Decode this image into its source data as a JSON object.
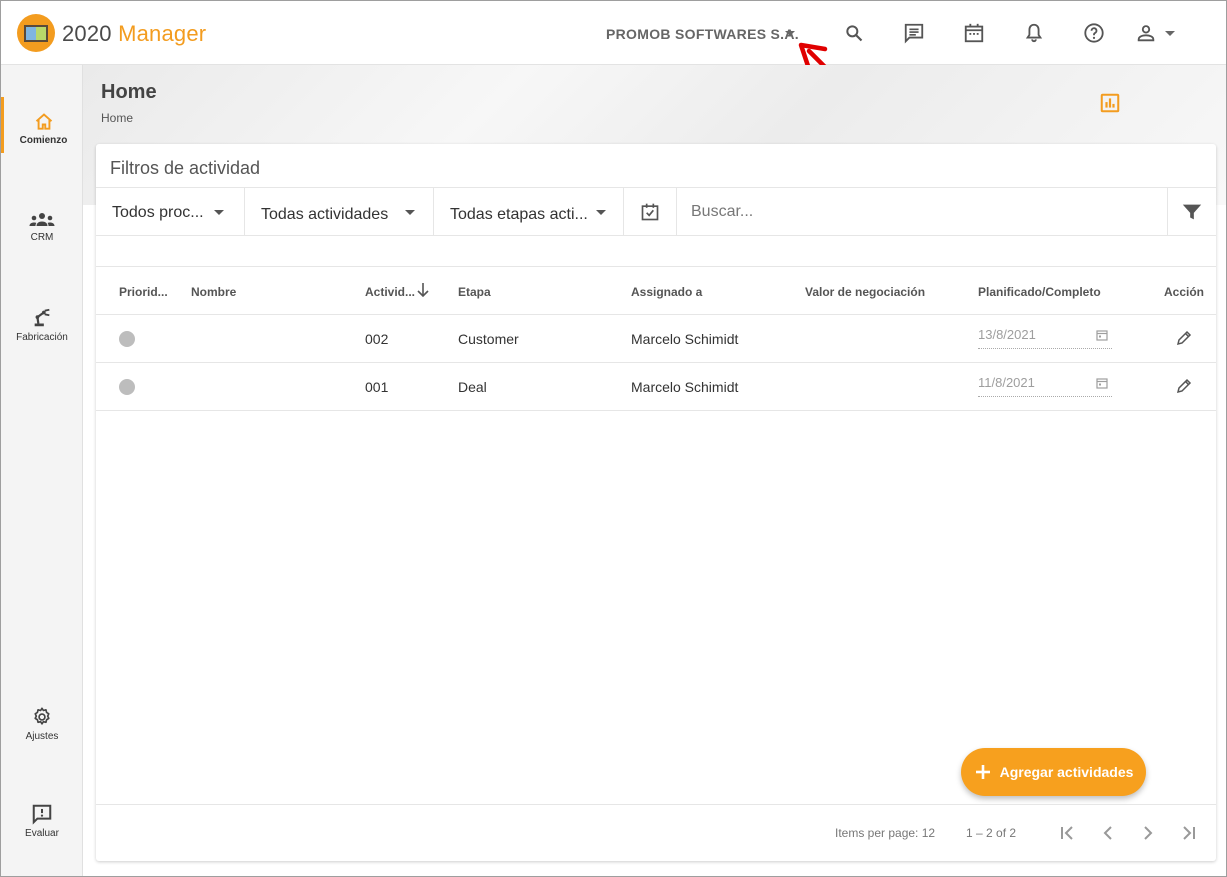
{
  "app": {
    "brand_prefix": "2020",
    "brand_suffix": "Manager",
    "company": "PROMOB SOFTWARES S.A."
  },
  "topbar": {
    "icons": [
      "search-icon",
      "chat-icon",
      "calendar-icon",
      "bell-icon",
      "help-icon",
      "user-icon"
    ]
  },
  "sidebar": {
    "items": [
      {
        "label": "Comienzo",
        "icon": "home-icon",
        "active": true
      },
      {
        "label": "CRM",
        "icon": "group-icon"
      },
      {
        "label": "Fabricación",
        "icon": "robot-arm-icon"
      },
      {
        "label": "Ajustes",
        "icon": "gear-icon"
      },
      {
        "label": "Evaluar",
        "icon": "feedback-icon"
      }
    ]
  },
  "page": {
    "title": "Home",
    "breadcrumb": "Home"
  },
  "card": {
    "title": "Filtros de actividad",
    "filters": {
      "process": "Todos proc...",
      "activities": "Todas actividades",
      "stages": "Todas etapas acti...",
      "search_placeholder": "Buscar..."
    }
  },
  "table": {
    "headers": {
      "priority": "Priorid...",
      "name": "Nombre",
      "activity": "Activid...",
      "stage": "Etapa",
      "assigned": "Assignado a",
      "value": "Valor de negociación",
      "planned": "Planificado/Completo",
      "action": "Acción"
    },
    "rows": [
      {
        "priority": "none",
        "name": "",
        "activity": "002",
        "stage": "Customer",
        "assigned": "Marcelo Schimidt",
        "value": "",
        "date": "13/8/2021"
      },
      {
        "priority": "none",
        "name": "",
        "activity": "001",
        "stage": "Deal",
        "assigned": "Marcelo Schimidt",
        "value": "",
        "date": "11/8/2021"
      }
    ]
  },
  "fab": {
    "label": "Agregar actividades"
  },
  "paginator": {
    "items_per_page_label": "Items per page:",
    "items_per_page": "12",
    "range": "1 – 2 of 2"
  },
  "colors": {
    "accent": "#f39c1f",
    "fab": "#f7a01e",
    "annotation": "#e00000"
  }
}
